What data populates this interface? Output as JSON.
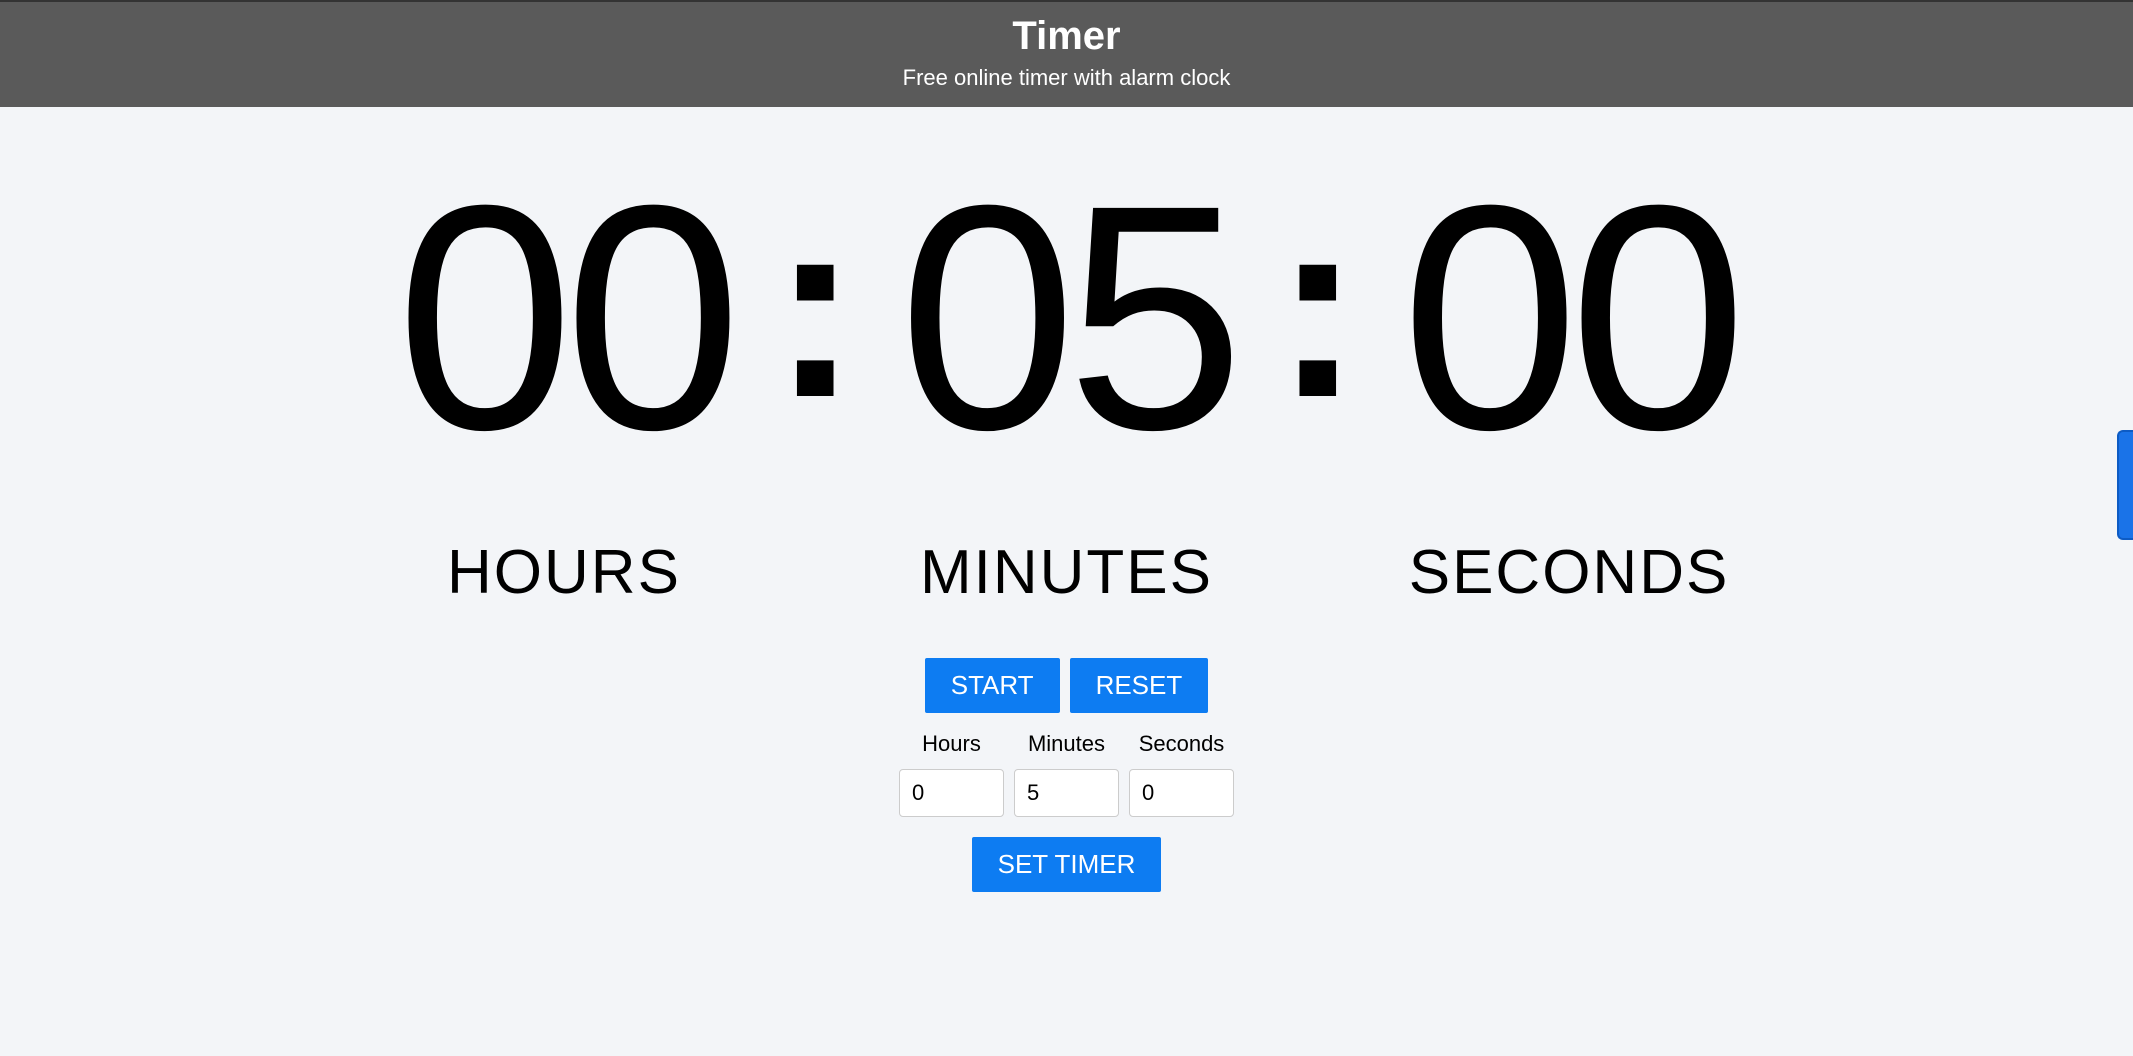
{
  "header": {
    "title": "Timer",
    "subtitle": "Free online timer with alarm clock"
  },
  "timer": {
    "hours_value": "00",
    "minutes_value": "05",
    "seconds_value": "00",
    "colon": ":",
    "hours_label": "HOURS",
    "minutes_label": "MINUTES",
    "seconds_label": "SECONDS"
  },
  "controls": {
    "start_label": "START",
    "reset_label": "RESET",
    "set_timer_label": "SET TIMER",
    "hours_input_label": "Hours",
    "minutes_input_label": "Minutes",
    "seconds_input_label": "Seconds",
    "hours_input_value": "0",
    "minutes_input_value": "5",
    "seconds_input_value": "0"
  }
}
